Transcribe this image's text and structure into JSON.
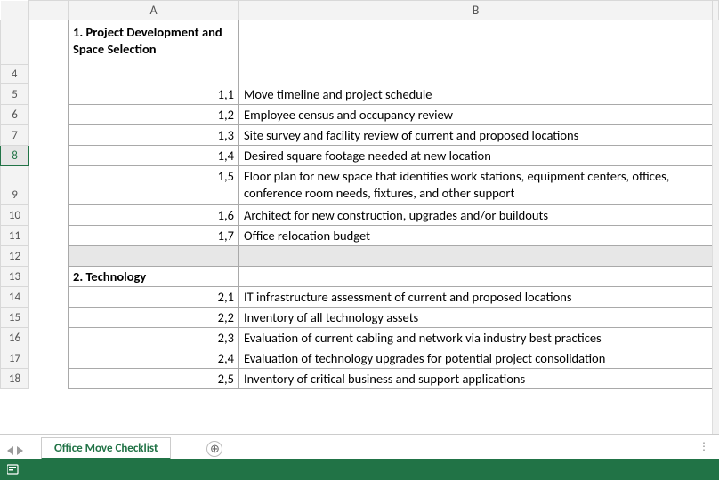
{
  "columns": {
    "A": "A",
    "B": "B"
  },
  "rows": [
    {
      "num": "",
      "a": "1. Project Development and Space Selection",
      "b": "",
      "section": true,
      "headerTall": true
    },
    {
      "num": "4",
      "spacer": true
    },
    {
      "num": "5",
      "a": "1,1",
      "b": "Move timeline and project schedule"
    },
    {
      "num": "6",
      "a": "1,2",
      "b": "Employee census and occupancy review"
    },
    {
      "num": "7",
      "a": "1,3",
      "b": "Site survey and facility review of current and proposed locations"
    },
    {
      "num": "8",
      "a": "1,4",
      "b": "Desired square footage needed at new location",
      "selected": true
    },
    {
      "num": "9",
      "a": "1,5",
      "b": "Floor plan for  new space that identifies work stations, equipment centers, offices, conference room needs, fixtures, and other support",
      "tall": true
    },
    {
      "num": "10",
      "a": "1,6",
      "b": "Architect for new construction, upgrades and/or buildouts"
    },
    {
      "num": "11",
      "a": "1,7",
      "b": "Office relocation budget"
    },
    {
      "num": "12",
      "a": "",
      "b": "",
      "blank": true
    },
    {
      "num": "13",
      "a": "2. Technology",
      "b": "",
      "section": true
    },
    {
      "num": "14",
      "a": "2,1",
      "b": "IT infrastructure assessment of current and proposed locations"
    },
    {
      "num": "15",
      "a": "2,2",
      "b": "Inventory of all technology assets"
    },
    {
      "num": "16",
      "a": "2,3",
      "b": "Evaluation of current cabling and network via industry best practices"
    },
    {
      "num": "17",
      "a": "2,4",
      "b": "Evaluation of technology upgrades for potential project consolidation"
    },
    {
      "num": "18",
      "a": "2,5",
      "b": "Inventory of critical business and support applications"
    }
  ],
  "sheet_tab": "Office Move Checklist",
  "new_sheet_glyph": "⊕",
  "tab_options_glyph": "⋮"
}
